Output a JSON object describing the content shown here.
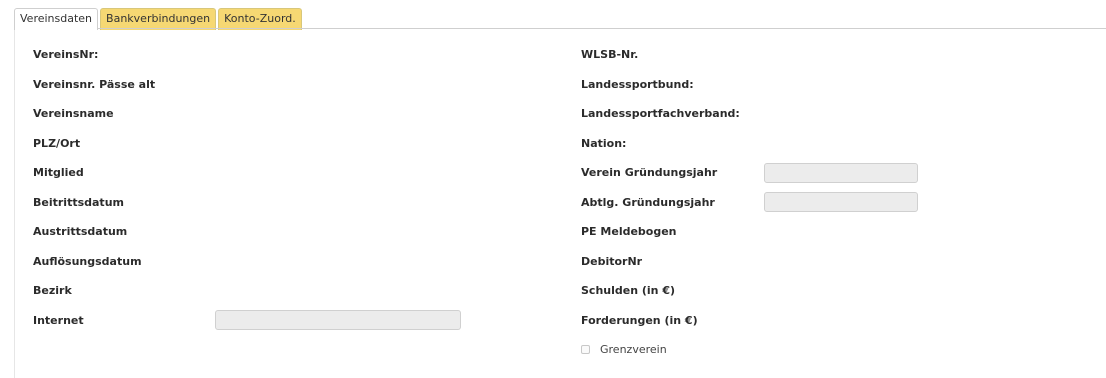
{
  "tabs": [
    {
      "label": "Vereinsdaten",
      "active": true
    },
    {
      "label": "Bankverbindungen",
      "active": false
    },
    {
      "label": "Konto-Zuord.",
      "active": false
    }
  ],
  "left": {
    "vereinsnr": "VereinsNr:",
    "vereinsnr_paesse_alt": "Vereinsnr. Pässe alt",
    "vereinsname": "Vereinsname",
    "plz_ort": "PLZ/Ort",
    "mitglied": "Mitglied",
    "beitrittsdatum": "Beitrittsdatum",
    "austrittsdatum": "Austrittsdatum",
    "aufloesungsdatum": "Auflösungsdatum",
    "bezirk": "Bezirk",
    "internet": "Internet",
    "internet_value": ""
  },
  "right": {
    "wlsb_nr": "WLSB-Nr.",
    "landessportbund": "Landessportbund:",
    "landessportfachverband": "Landessportfachverband:",
    "nation": "Nation:",
    "verein_gruendungsjahr": "Verein Gründungsjahr",
    "verein_gruendungsjahr_value": "",
    "abtlg_gruendungsjahr": "Abtlg. Gründungsjahr",
    "abtlg_gruendungsjahr_value": "",
    "pe_meldebogen": "PE Meldebogen",
    "debitornr": "DebitorNr",
    "schulden": "Schulden (in €)",
    "forderungen": "Forderungen (in €)",
    "grenzverein": "Grenzverein",
    "grenzverein_checked": false
  }
}
